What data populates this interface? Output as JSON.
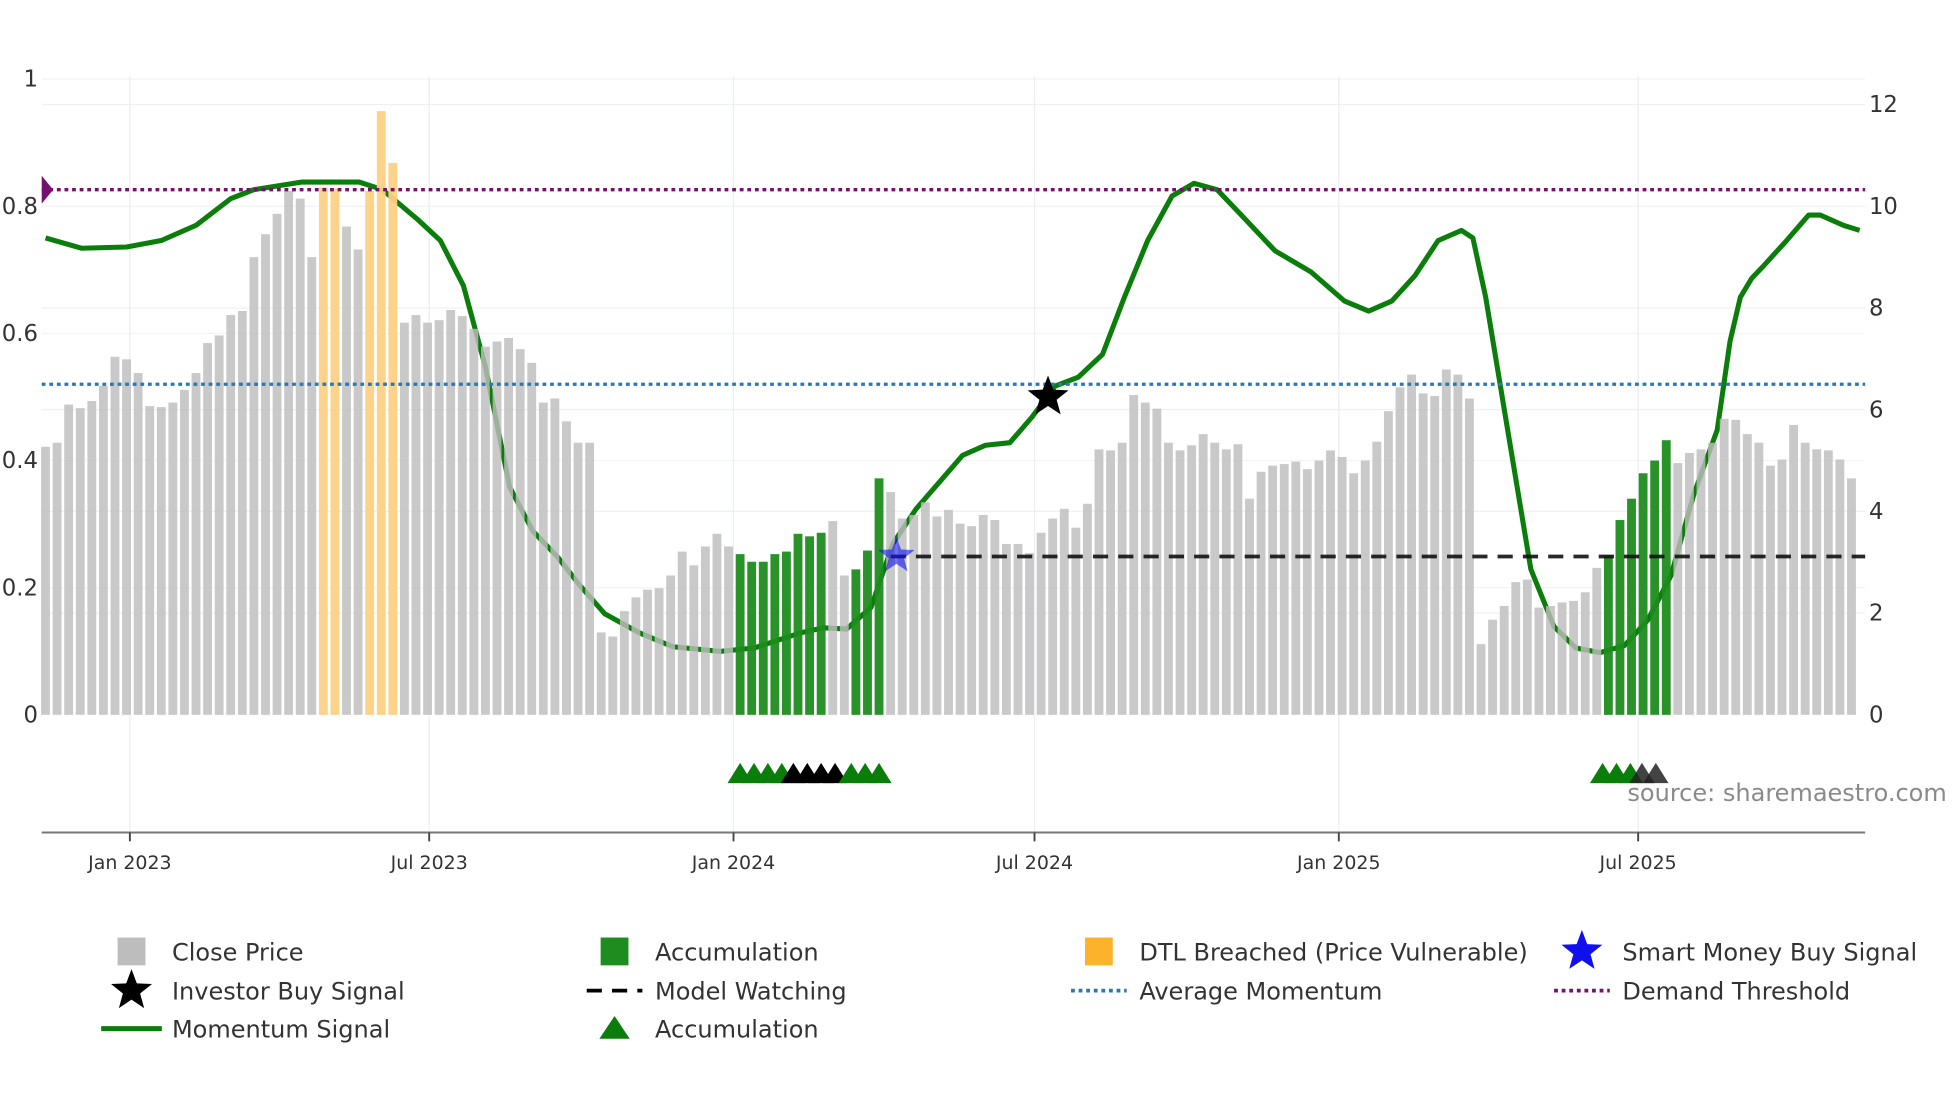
{
  "chart_data": {
    "type": "bar",
    "title": "",
    "source_note": "source: sharemaestro.com",
    "x_axis": {
      "type": "date",
      "first_bar_date": "2022-11-11",
      "bar_interval_days": 7,
      "ticks": [
        {
          "date": "2023-01-01",
          "label": "Jan 2023"
        },
        {
          "date": "2023-07-01",
          "label": "Jul 2023"
        },
        {
          "date": "2024-01-01",
          "label": "Jan 2024"
        },
        {
          "date": "2024-07-01",
          "label": "Jul 2024"
        },
        {
          "date": "2025-01-01",
          "label": "Jan 2025"
        },
        {
          "date": "2025-07-01",
          "label": "Jul 2025"
        }
      ]
    },
    "y_left": {
      "range": [
        0,
        1
      ],
      "ticks": [
        "0",
        "0.2",
        "0.4",
        "0.6",
        "0.8",
        "1"
      ],
      "tick_values": [
        0,
        0.2,
        0.4,
        0.6,
        0.8,
        1
      ]
    },
    "y_right": {
      "range": [
        0,
        12
      ],
      "ticks": [
        "0",
        "2",
        "4",
        "6",
        "8",
        "10",
        "12"
      ],
      "tick_values": [
        0,
        2,
        4,
        6,
        8,
        10,
        12
      ]
    },
    "close_price": [
      5.27,
      5.35,
      6.1,
      6.03,
      6.17,
      6.47,
      7.04,
      6.99,
      6.72,
      6.07,
      6.05,
      6.14,
      6.39,
      6.72,
      7.31,
      7.46,
      7.86,
      7.94,
      9.0,
      9.45,
      9.85,
      10.3,
      10.15,
      9.0,
      10.37,
      10.35,
      9.6,
      9.15,
      10.3,
      11.87,
      10.85,
      7.71,
      7.86,
      7.71,
      7.76,
      7.96,
      7.84,
      7.59,
      7.24,
      7.34,
      7.41,
      7.19,
      6.92,
      6.14,
      6.22,
      5.77,
      5.35,
      5.35,
      1.62,
      1.54,
      2.04,
      2.31,
      2.46,
      2.49,
      2.74,
      3.21,
      2.94,
      3.31,
      3.56,
      3.31,
      3.16,
      3.01,
      3.01,
      3.16,
      3.21,
      3.56,
      3.51,
      3.58,
      3.81,
      2.74,
      2.86,
      3.23,
      4.65,
      4.38,
      3.86,
      3.93,
      4.18,
      3.9,
      4.03,
      3.76,
      3.71,
      3.93,
      3.83,
      3.36,
      3.36,
      3.18,
      3.58,
      3.86,
      4.05,
      3.68,
      4.15,
      5.22,
      5.2,
      5.35,
      6.29,
      6.14,
      6.02,
      5.35,
      5.2,
      5.3,
      5.52,
      5.35,
      5.22,
      5.32,
      4.25,
      4.78,
      4.9,
      4.93,
      4.98,
      4.83,
      5.0,
      5.2,
      5.07,
      4.75,
      5.0,
      5.37,
      5.97,
      6.44,
      6.69,
      6.32,
      6.27,
      6.79,
      6.69,
      6.22,
      1.39,
      1.87,
      2.14,
      2.61,
      2.66,
      2.11,
      2.14,
      2.21,
      2.24,
      2.41,
      2.89,
      3.13,
      3.83,
      4.25,
      4.75,
      5.0,
      5.4,
      4.95,
      5.15,
      5.22,
      5.35,
      5.82,
      5.8,
      5.52,
      5.35,
      4.9,
      5.02,
      5.7,
      5.35,
      5.22,
      5.2,
      5.02,
      4.65
    ],
    "bar_state_legend": {
      "C": "Close Price",
      "A": "Accumulation",
      "D": "DTL Breached (Price Vulnerable)"
    },
    "bar_state": "CCCCCCCCCCCCCCCCCCCCCCCCDDCCDDDCCCCCCCCCCCCCCCCCCCCCCCCCCCCCAAAAAAAACCAAACCCCCCCCCCCCCCCCCCCCCCCCCCCCCCCCCCCCCCCCCCCCCCCCCCCCCCCCCCCCCCAAAAAACCCCCCCCCCCCCCCCCC",
    "momentum_signal": [
      [
        0,
        0.75
      ],
      [
        3.1,
        0.734
      ],
      [
        7,
        0.736
      ],
      [
        10,
        0.746
      ],
      [
        13,
        0.77
      ],
      [
        16,
        0.812
      ],
      [
        18,
        0.826
      ],
      [
        22.1,
        0.838
      ],
      [
        27.1,
        0.838
      ],
      [
        29.1,
        0.826
      ],
      [
        32.1,
        0.78
      ],
      [
        34.1,
        0.746
      ],
      [
        36.1,
        0.675
      ],
      [
        38,
        0.547
      ],
      [
        40.1,
        0.358
      ],
      [
        42.1,
        0.289
      ],
      [
        44.2,
        0.249
      ],
      [
        46.1,
        0.205
      ],
      [
        48.3,
        0.159
      ],
      [
        51.3,
        0.129
      ],
      [
        54.2,
        0.107
      ],
      [
        58.3,
        0.1
      ],
      [
        61.2,
        0.105
      ],
      [
        65.2,
        0.129
      ],
      [
        67.2,
        0.137
      ],
      [
        69.2,
        0.135
      ],
      [
        71.3,
        0.169
      ],
      [
        73.2,
        0.269
      ],
      [
        75.2,
        0.324
      ],
      [
        77.3,
        0.368
      ],
      [
        79.2,
        0.408
      ],
      [
        81.2,
        0.424
      ],
      [
        83.3,
        0.428
      ],
      [
        85.2,
        0.468
      ],
      [
        87.2,
        0.517
      ],
      [
        89.2,
        0.531
      ],
      [
        91.3,
        0.567
      ],
      [
        93.2,
        0.657
      ],
      [
        95.2,
        0.746
      ],
      [
        97.3,
        0.816
      ],
      [
        99.2,
        0.836
      ],
      [
        101.2,
        0.826
      ],
      [
        103.3,
        0.786
      ],
      [
        106.2,
        0.73
      ],
      [
        109.3,
        0.697
      ],
      [
        112.2,
        0.651
      ],
      [
        114.3,
        0.635
      ],
      [
        116.3,
        0.651
      ],
      [
        118.3,
        0.691
      ],
      [
        120.3,
        0.746
      ],
      [
        122.3,
        0.762
      ],
      [
        123.3,
        0.75
      ],
      [
        124.4,
        0.657
      ],
      [
        126.3,
        0.448
      ],
      [
        128.3,
        0.229
      ],
      [
        130.3,
        0.139
      ],
      [
        132.2,
        0.105
      ],
      [
        134.3,
        0.098
      ],
      [
        136.4,
        0.109
      ],
      [
        138.4,
        0.149
      ],
      [
        140.4,
        0.219
      ],
      [
        142.4,
        0.348
      ],
      [
        143.4,
        0.398
      ],
      [
        144.4,
        0.448
      ],
      [
        145.5,
        0.587
      ],
      [
        146.4,
        0.657
      ],
      [
        147.4,
        0.687
      ],
      [
        148.4,
        0.706
      ],
      [
        150.4,
        0.746
      ],
      [
        152.3,
        0.786
      ],
      [
        153.3,
        0.786
      ],
      [
        155.3,
        0.77
      ],
      [
        156.7,
        0.762
      ]
    ],
    "average_momentum": 0.52,
    "demand_threshold": 0.826,
    "model_watching": {
      "level": 0.249,
      "from_index": 73
    },
    "investor_buy_signal": [
      {
        "index": 86.6,
        "value": 0.5
      }
    ],
    "smart_money_buy_signal": [
      {
        "index": 73.5,
        "value": 0.25
      }
    ],
    "accumulation_markers": [
      {
        "index": 60,
        "color": "green"
      },
      {
        "index": 61.2,
        "color": "green"
      },
      {
        "index": 62.4,
        "color": "green"
      },
      {
        "index": 63.6,
        "color": "green"
      },
      {
        "index": 64.6,
        "color": "black"
      },
      {
        "index": 65.8,
        "color": "black"
      },
      {
        "index": 67,
        "color": "black"
      },
      {
        "index": 68.2,
        "color": "black"
      },
      {
        "index": 69.6,
        "color": "green"
      },
      {
        "index": 70.8,
        "color": "green"
      },
      {
        "index": 72,
        "color": "green"
      },
      {
        "index": 134.5,
        "color": "green"
      },
      {
        "index": 135.7,
        "color": "green"
      },
      {
        "index": 136.9,
        "color": "green"
      },
      {
        "index": 137.9,
        "color": "dark"
      },
      {
        "index": 139.1,
        "color": "dark"
      }
    ],
    "legend": [
      {
        "label": "Close Price",
        "symbol": "grey-square"
      },
      {
        "label": "Accumulation",
        "symbol": "green-square"
      },
      {
        "label": "DTL Breached (Price Vulnerable)",
        "symbol": "orange-square"
      },
      {
        "label": "Smart Money Buy Signal",
        "symbol": "blue-star"
      },
      {
        "label": "Investor Buy Signal",
        "symbol": "black-star"
      },
      {
        "label": "Model Watching",
        "symbol": "black-dash"
      },
      {
        "label": "Average Momentum",
        "symbol": "blue-dot"
      },
      {
        "label": "Demand Threshold",
        "symbol": "purple-dot"
      },
      {
        "label": "Momentum Signal",
        "symbol": "green-line"
      },
      {
        "label": "Accumulation",
        "symbol": "green-triangle"
      }
    ],
    "legend_placement": "bottom",
    "colors": {
      "close": "#bdbdbd",
      "accumulation": "#1e8c1e",
      "dtl_bar": "#fdd084",
      "dtl_legend": "#fdb22c",
      "momentum": "#0b7d0b",
      "avg": "#2b78b0",
      "threshold": "#76106e",
      "smart": "#1010ee"
    }
  }
}
